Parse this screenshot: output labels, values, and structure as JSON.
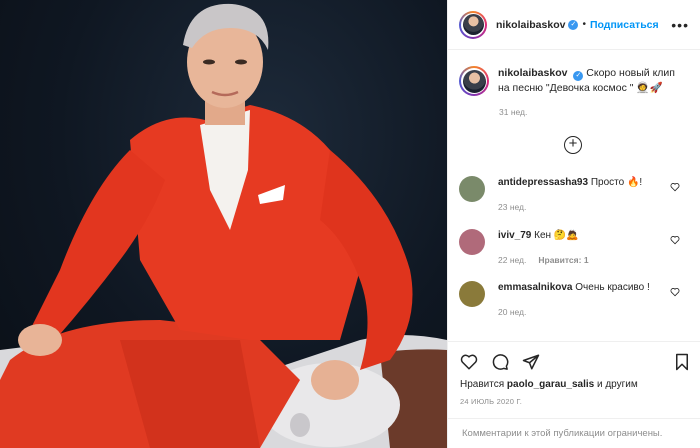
{
  "post": {
    "username": "nikolaibaskov",
    "follow_label": "Подписаться",
    "dot": "•",
    "more_label": "•••",
    "caption_text": "Скоро новый клип на песню \"Девочка космос \" 🧑‍🚀🚀",
    "caption_time": "31 нед.",
    "load_more": "+"
  },
  "comments": [
    {
      "username": "antidepressasha93",
      "text": "Просто 🔥!",
      "time": "23 нед.",
      "likes": "",
      "avatar_color": "#7a8a6a"
    },
    {
      "username": "iviv_79",
      "text": "Кен 🤔🙇",
      "time": "22 нед.",
      "likes": "Нравится: 1",
      "avatar_color": "#b06a7a"
    },
    {
      "username": "emmasalnikova",
      "text": "Очень красиво !",
      "time": "20 нед.",
      "likes": "",
      "avatar_color": "#8a7a3a"
    }
  ],
  "footer": {
    "liked_prefix": "Нравится",
    "liked_user": "paolo_garau_salis",
    "liked_suffix": "и другим",
    "date": "24 ИЮЛЬ 2020 Г.",
    "comments_limited": "Комментарии к этой публикации ограничены."
  },
  "colors": {
    "accent": "#0095f6",
    "suit": "#e63a22",
    "background": "#0f1722"
  }
}
